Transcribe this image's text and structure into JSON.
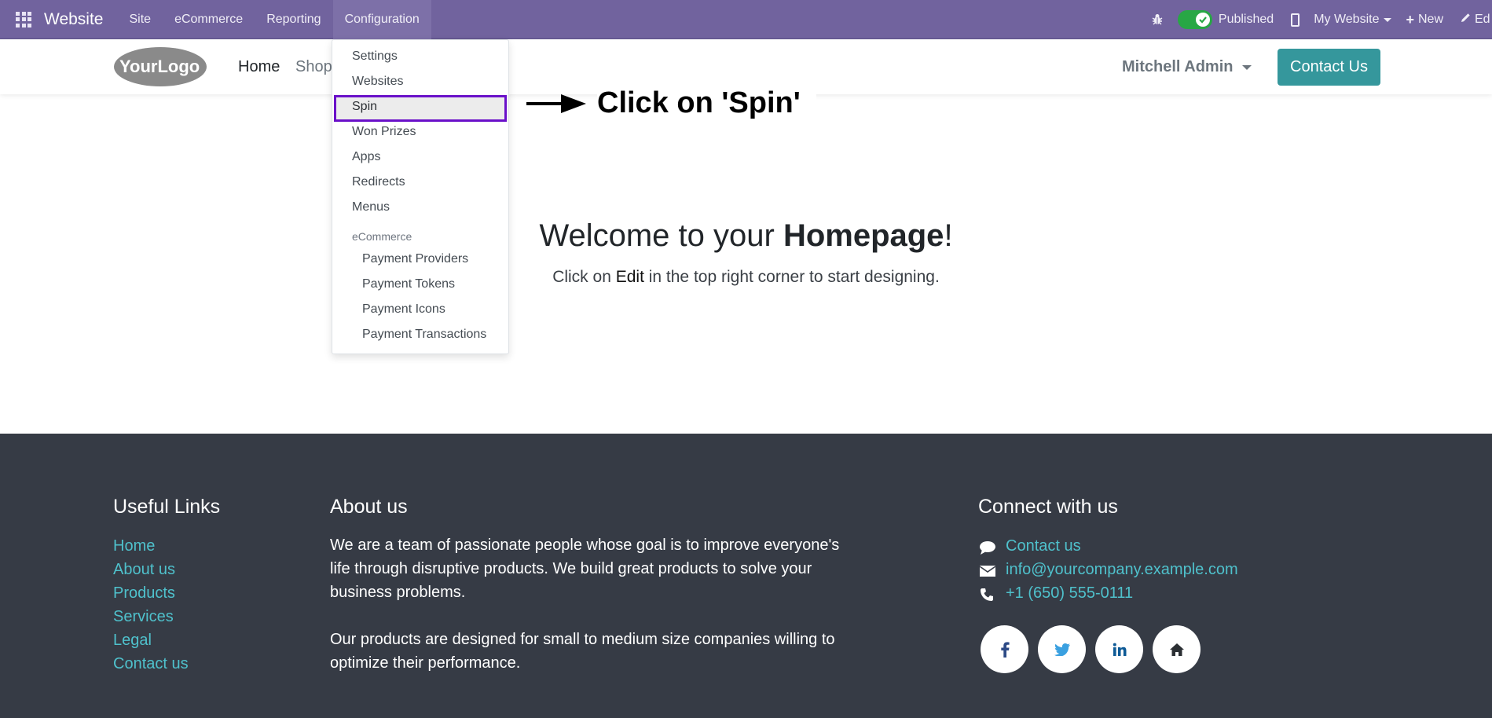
{
  "topbar": {
    "app_name": "Website",
    "menu": [
      "Site",
      "eCommerce",
      "Reporting",
      "Configuration"
    ],
    "published_label": "Published",
    "website_selector": "My Website",
    "new_label": "New",
    "edit_label": "Ed",
    "colors": {
      "bar": "#71639e",
      "toggle_on": "#28a745"
    }
  },
  "site_header": {
    "logo_text": "YourLogo",
    "nav": [
      "Home",
      "Shop"
    ],
    "user_name": "Mitchell Admin",
    "contact_button": "Contact Us",
    "colors": {
      "button": "#35979c"
    }
  },
  "dropdown": {
    "items": [
      "Settings",
      "Websites",
      "Spin",
      "Won Prizes",
      "Apps",
      "Redirects",
      "Menus"
    ],
    "section_header": "eCommerce",
    "sub_items": [
      "Payment Providers",
      "Payment Tokens",
      "Payment Icons",
      "Payment Transactions"
    ],
    "highlight_color": "#6a10c9"
  },
  "annotation": {
    "text": "Click on 'Spin'"
  },
  "main": {
    "welcome_prefix": "Welcome to your ",
    "welcome_bold": "Homepage",
    "welcome_suffix": "!",
    "sub_prefix": "Click on ",
    "sub_bold": "Edit",
    "sub_suffix": " in the top right corner to start designing."
  },
  "footer": {
    "useful_links_title": "Useful Links",
    "useful_links": [
      "Home",
      "About us",
      "Products",
      "Services",
      "Legal",
      "Contact us"
    ],
    "about_title": "About us",
    "about_p1_lines": [
      "We are a team of passionate people whose goal is to improve everyone's",
      "life through disruptive products. We build great products to solve your",
      "business problems."
    ],
    "about_p2_lines": [
      "Our products are designed for small to medium size companies willing to",
      "optimize their performance."
    ],
    "connect_title": "Connect with us",
    "contact_link": "Contact us",
    "email": "info@yourcompany.example.com",
    "phone": "+1 (650) 555-0111",
    "social": [
      "facebook-icon",
      "twitter-icon",
      "linkedin-icon",
      "home-icon"
    ],
    "colors": {
      "background": "#363b45",
      "link": "#4fc1cc"
    }
  }
}
